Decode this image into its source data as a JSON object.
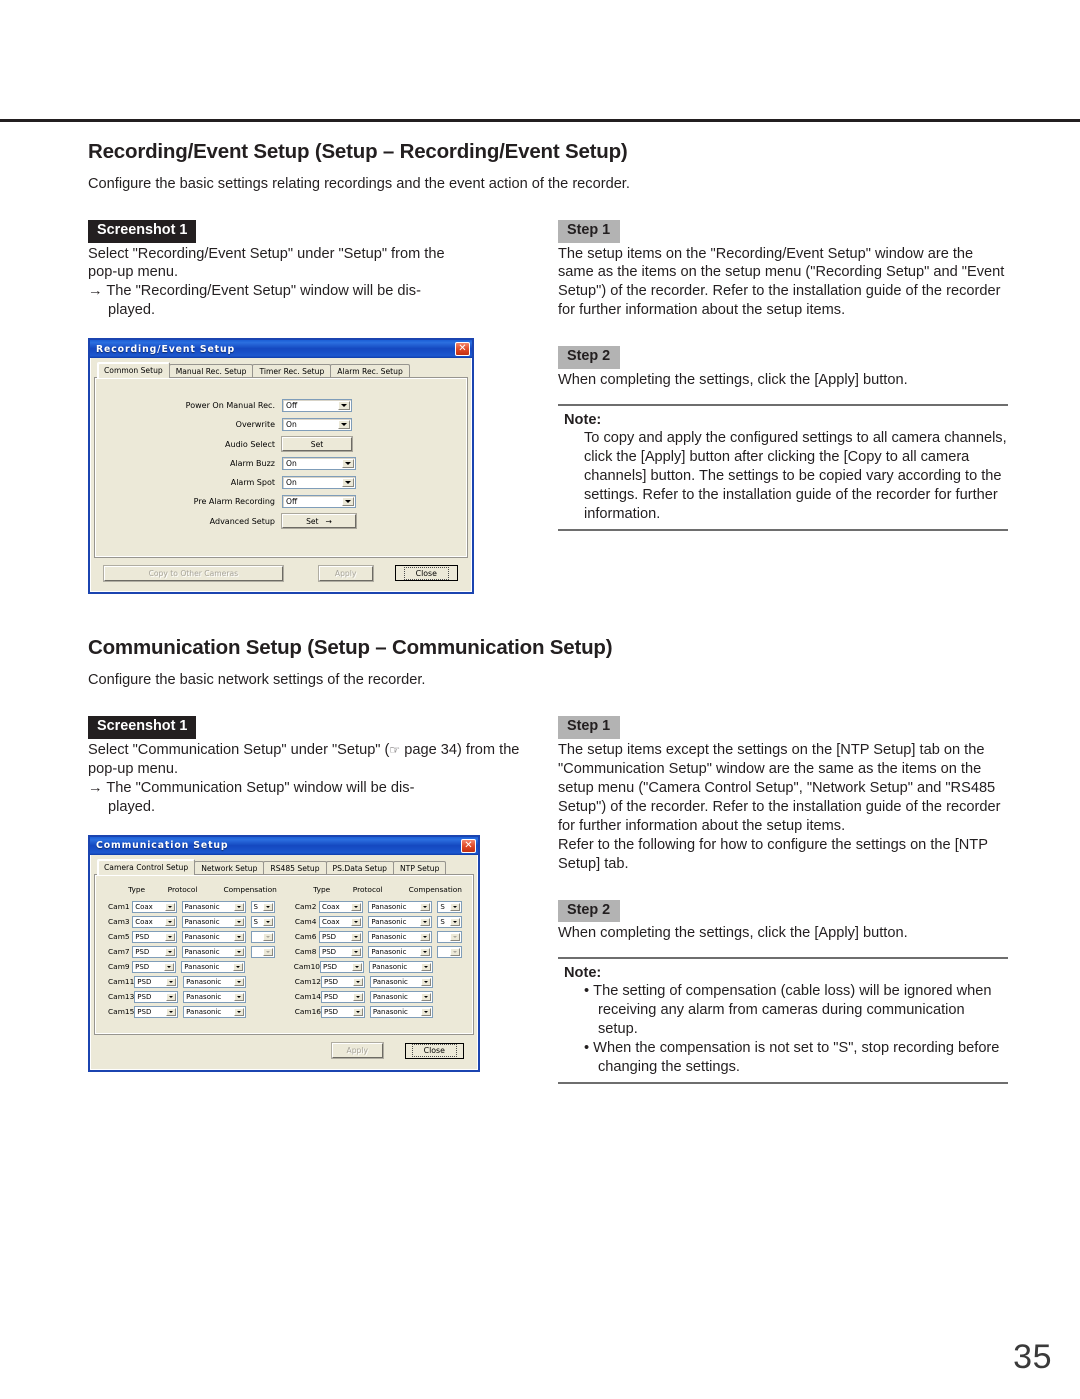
{
  "page": {
    "number": "35"
  },
  "sections": [
    {
      "title": "Recording/Event Setup (Setup – Recording/Event Setup)",
      "lede": "Configure the basic settings relating recordings and the event action of the recorder.",
      "screenshot_badge": "Screenshot 1",
      "intro_line1": "Select \"Recording/Event Setup\" under \"Setup\" from the",
      "intro_line2": "pop-up menu.",
      "arrow_line1": "→ The \"Recording/Event Setup\" window will be dis-",
      "arrow_line2": "played.",
      "steps": [
        {
          "badge": "Step 1",
          "text": "The setup items on the \"Recording/Event Setup\" window are the same as the items on the setup menu (\"Recording Setup\" and \"Event Setup\") of the recorder. Refer to the installation guide of the recorder for further information about the setup items."
        },
        {
          "badge": "Step 2",
          "text": "When completing the settings, click the [Apply] button."
        }
      ],
      "note": {
        "title": "Note:",
        "paragraphs": [
          "To copy and apply the configured settings to all camera channels, click the [Apply] button after clicking the [Copy to all camera channels] button. The settings to be copied vary according to the settings. Refer to the installation guide of the recorder for further information."
        ]
      }
    },
    {
      "title": "Communication Setup (Setup – Communication Setup)",
      "lede": "Configure the basic network settings of the recorder.",
      "screenshot_badge": "Screenshot 1",
      "intro_pre": "Select \"Communication Setup\" under \"Setup\" (",
      "intro_icon": "☞",
      "intro_post": " page 34) from the pop-up menu.",
      "arrow_line1": "→ The \"Communication Setup\" window will be dis-",
      "arrow_line2": "played.",
      "steps": [
        {
          "badge": "Step 1",
          "text": "The setup items except the settings on the [NTP Setup] tab on the \"Communication Setup\" window are the same as the items on the setup menu (\"Camera Control Setup\", \"Network Setup\" and \"RS485 Setup\") of the recorder. Refer to the installation guide of the recorder for further information about the setup items.",
          "text2": "Refer to the following for how to configure the settings on the [NTP Setup] tab."
        },
        {
          "badge": "Step 2",
          "text": "When completing the settings, click the [Apply] button."
        }
      ],
      "note": {
        "title": "Note:",
        "bullets": [
          "The setting of compensation (cable loss) will be ignored when receiving any alarm from cameras during communication setup.",
          "When the compensation is not set to \"S\", stop recording before changing the settings."
        ]
      }
    }
  ],
  "dialog_recording": {
    "title": "Recording/Event Setup",
    "close_glyph": "✕",
    "tabs": [
      {
        "label": "Common Setup",
        "active": true
      },
      {
        "label": "Manual Rec. Setup",
        "active": false
      },
      {
        "label": "Timer Rec. Setup",
        "active": false
      },
      {
        "label": "Alarm Rec. Setup",
        "active": false
      }
    ],
    "fields": [
      {
        "label": "Power On Manual Rec.",
        "type": "combo",
        "value": "Off"
      },
      {
        "label": "Overwrite",
        "type": "combo",
        "value": "On"
      },
      {
        "label": "Audio Select",
        "type": "button",
        "value": "Set"
      },
      {
        "label": "Alarm Buzz",
        "type": "combo",
        "value": "On"
      },
      {
        "label": "Alarm Spot",
        "type": "combo",
        "value": "On"
      },
      {
        "label": "Pre Alarm Recording",
        "type": "combo",
        "value": "Off"
      },
      {
        "label": "Advanced Setup",
        "type": "button-arrow",
        "value": "Set",
        "arrow": "→"
      }
    ],
    "footer": {
      "copy_label": "Copy to Other Cameras",
      "apply_label": "Apply",
      "close_label": "Close"
    }
  },
  "dialog_communication": {
    "title": "Communication Setup",
    "close_glyph": "✕",
    "tabs": [
      {
        "label": "Camera Control Setup",
        "active": true
      },
      {
        "label": "Network Setup",
        "active": false
      },
      {
        "label": "RS485 Setup",
        "active": false
      },
      {
        "label": "PS.Data Setup",
        "active": false
      },
      {
        "label": "NTP Setup",
        "active": false
      }
    ],
    "columns": [
      "Type",
      "Protocol",
      "Compensation"
    ],
    "rows": [
      {
        "left": {
          "cam": "Cam1",
          "type": "Coax",
          "protocol": "Panasonic",
          "compensation": "S"
        },
        "right": {
          "cam": "Cam2",
          "type": "Coax",
          "protocol": "Panasonic",
          "compensation": "S"
        }
      },
      {
        "left": {
          "cam": "Cam3",
          "type": "Coax",
          "protocol": "Panasonic",
          "compensation": "S"
        },
        "right": {
          "cam": "Cam4",
          "type": "Coax",
          "protocol": "Panasonic",
          "compensation": "S"
        }
      },
      {
        "left": {
          "cam": "Cam5",
          "type": "PSD",
          "protocol": "Panasonic",
          "compensation": ""
        },
        "right": {
          "cam": "Cam6",
          "type": "PSD",
          "protocol": "Panasonic",
          "compensation": ""
        }
      },
      {
        "left": {
          "cam": "Cam7",
          "type": "PSD",
          "protocol": "Panasonic",
          "compensation": ""
        },
        "right": {
          "cam": "Cam8",
          "type": "PSD",
          "protocol": "Panasonic",
          "compensation": ""
        }
      },
      {
        "left": {
          "cam": "Cam9",
          "type": "PSD",
          "protocol": "Panasonic",
          "compensation": null
        },
        "right": {
          "cam": "Cam10",
          "type": "PSD",
          "protocol": "Panasonic",
          "compensation": null
        }
      },
      {
        "left": {
          "cam": "Cam11",
          "type": "PSD",
          "protocol": "Panasonic",
          "compensation": null
        },
        "right": {
          "cam": "Cam12",
          "type": "PSD",
          "protocol": "Panasonic",
          "compensation": null
        }
      },
      {
        "left": {
          "cam": "Cam13",
          "type": "PSD",
          "protocol": "Panasonic",
          "compensation": null
        },
        "right": {
          "cam": "Cam14",
          "type": "PSD",
          "protocol": "Panasonic",
          "compensation": null
        }
      },
      {
        "left": {
          "cam": "Cam15",
          "type": "PSD",
          "protocol": "Panasonic",
          "compensation": null
        },
        "right": {
          "cam": "Cam16",
          "type": "PSD",
          "protocol": "Panasonic",
          "compensation": null
        }
      }
    ],
    "footer": {
      "apply_label": "Apply",
      "close_label": "Close"
    }
  },
  "colors": {
    "badge_screenshot_bg": "#231f20",
    "badge_step_bg": "#b3b3b3",
    "dialog_face": "#ece9d8",
    "dialog_border": "#1b44b0",
    "titlebar_blue": "#1448c0",
    "close_red": "#e04a26"
  }
}
